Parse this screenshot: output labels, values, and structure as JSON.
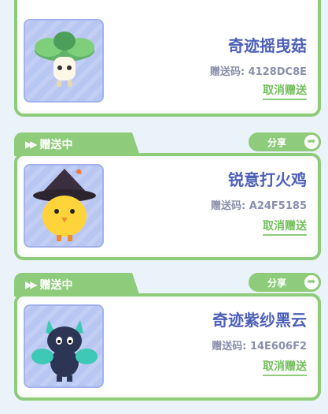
{
  "cards": [
    {
      "name": "奇迹摇曳菇",
      "code": "赠送码: 4128DC8E",
      "cancel_label": "取消赠送",
      "status_label": "",
      "share_label": ""
    },
    {
      "name": "锐意打火鸡",
      "code": "赠送码: A24F5185",
      "cancel_label": "取消赠送",
      "status_label": "赠送中",
      "share_label": "分享"
    },
    {
      "name": "奇迹紫纱黑云",
      "code": "赠送码: 14E606F2",
      "cancel_label": "取消赠送",
      "status_label": "赠送中",
      "share_label": "分享"
    }
  ],
  "icons": {
    "status": "fast-forward-icon",
    "share": "share-arrow-icon"
  },
  "colors": {
    "accent_green": "#8ecb7a",
    "title_blue": "#4d60b8",
    "code_gray": "#8b8fab",
    "thumb_bg": "#b8c6f2"
  }
}
